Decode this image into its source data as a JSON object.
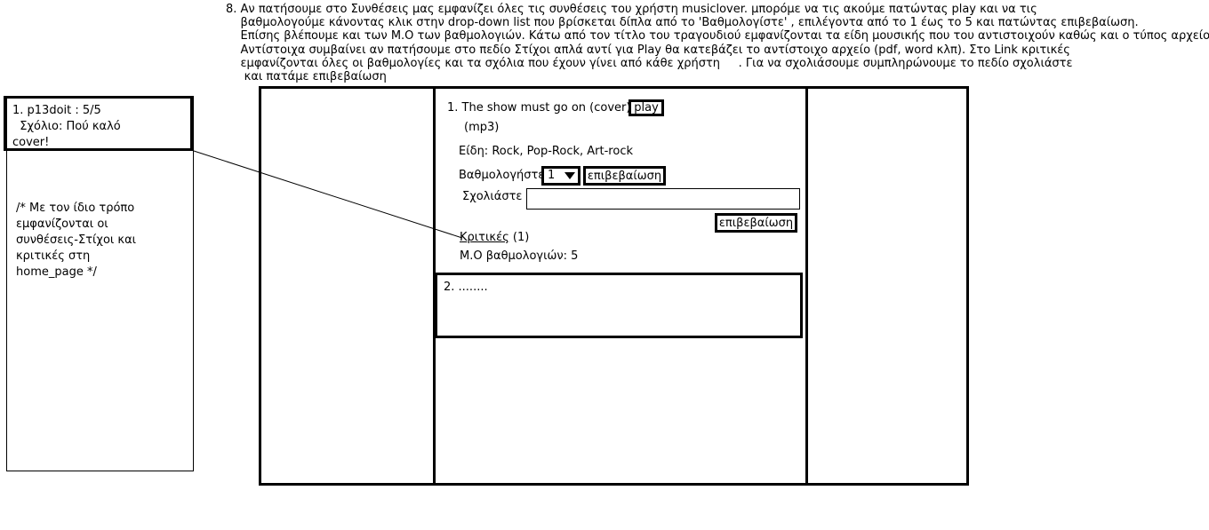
{
  "description": {
    "lines": [
      "8. Αν πατήσουμε στο  Συνθέσεις  μας εμφανίζει  όλες τις συνθέσεις του χρήστη musiclover. μπορόμε να τις ακούμε πατώντας play και να τις",
      "    βαθμολογούμε κάνοντας κλικ στην drop-down list που βρίσκεται δίπλα από το 'Βαθμολογίστε' , επιλέγοντα από το 1 έως το 5 και πατώντας επιβεβαίωση.",
      "    Επίσης βλέπουμε και των Μ.Ο των βαθμολογιών. Κάτω από τον τίτλο του τραγουδιού εμφανίζονται τα είδη μουσικής που του αντιστοιχούν καθώς και ο τύπος αρχείου",
      "    Αντίστοιχα συμβαίνει αν πατήσουμε στο πεδίο Στίχοι απλά αντί για Play θα κατεβάζει το αντίστοιχο αρχείο (pdf, word κλπ). Στο Link κριτικές",
      "    εμφανίζονται όλες οι βαθμολογίες και τα σχόλια που έχουν γίνει από κάθε χρήστη     . Για να σχολιάσουμε συμπληρώνουμε το πεδίο σχολιάστε",
      "     και πατάμε επιβεβαίωση"
    ]
  },
  "review_popup": {
    "line1": "1. p13doit : 5/5",
    "line2": "  Σχόλιο: Πού καλό",
    "line3": "cover!"
  },
  "side_note": {
    "lines": [
      "/* Με τον ίδιο τρόπο",
      "εμφανίζονται οι",
      "συνθέσεις-Στίχοι και",
      "κριτικές στη",
      "home_page */"
    ]
  },
  "song": {
    "title": "1. The show must go on (cover)",
    "play_label": "play",
    "file_type": "(mp3)",
    "genres": "Είδη: Rock, Pop-Rock, Art-rock",
    "rate_label": "Βαθμολογήστε",
    "rating_selected": "1",
    "confirm_rating_label": "επιβεβαίωση",
    "comment_label": "Σχολιάστε",
    "comment_value": "",
    "confirm_comment_label": "επιβεβαίωση",
    "reviews_link": "Κριτικές",
    "reviews_count": "(1)",
    "avg_rating": "Μ.Ο βαθμολογιών:  5"
  },
  "song2": {
    "title": "2. ........"
  }
}
